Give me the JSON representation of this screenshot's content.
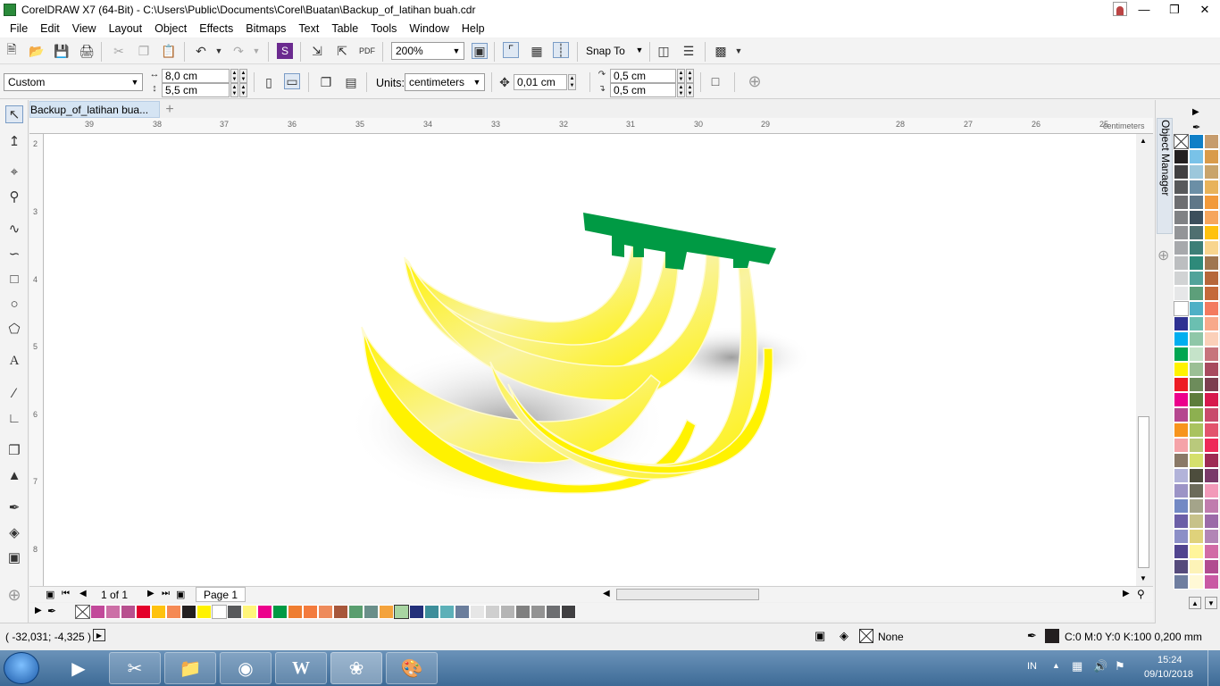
{
  "window": {
    "title": "CorelDRAW X7 (64-Bit) - C:\\Users\\Public\\Documents\\Corel\\Buatan\\Backup_of_latihan buah.cdr"
  },
  "menu": [
    "File",
    "Edit",
    "View",
    "Layout",
    "Object",
    "Effects",
    "Bitmaps",
    "Text",
    "Table",
    "Tools",
    "Window",
    "Help"
  ],
  "toolbar": {
    "zoom_value": "200%",
    "snap_to_label": "Snap To"
  },
  "property_bar": {
    "page_preset": "Custom",
    "page_width": "8,0 cm",
    "page_height": "5,5 cm",
    "units_label": "Units:",
    "units_value": "centimeters",
    "nudge_value": "0,01 cm",
    "dup_x": "0,5 cm",
    "dup_y": "0,5 cm"
  },
  "document": {
    "tab_label": "Backup_of_latihan bua...",
    "ruler_unit": "centimeters",
    "h_ruler_labels": [
      "39",
      "38",
      "37",
      "36",
      "35",
      "34",
      "33",
      "32",
      "31",
      "30",
      "29",
      "28",
      "27",
      "26",
      "25"
    ],
    "v_ruler_labels": [
      "2",
      "3",
      "4",
      "5",
      "6",
      "7",
      "8"
    ],
    "page_counter": "1 of 1",
    "page_tab": "Page 1"
  },
  "docker": {
    "title": "Object Manager"
  },
  "status": {
    "cursor_coords": "( -32,031; -4,325 )",
    "fill_label": "None",
    "outline_info": "C:0 M:0 Y:0 K:100  0,200 mm"
  },
  "taskbar": {
    "language": "IN",
    "time": "15:24",
    "date": "09/10/2018"
  },
  "colors": {
    "banana_yellow": "#FFF200",
    "banana_light": "#F9F3A0",
    "stem_green": "#009A44",
    "selected_tab": "#D5E4F3"
  }
}
